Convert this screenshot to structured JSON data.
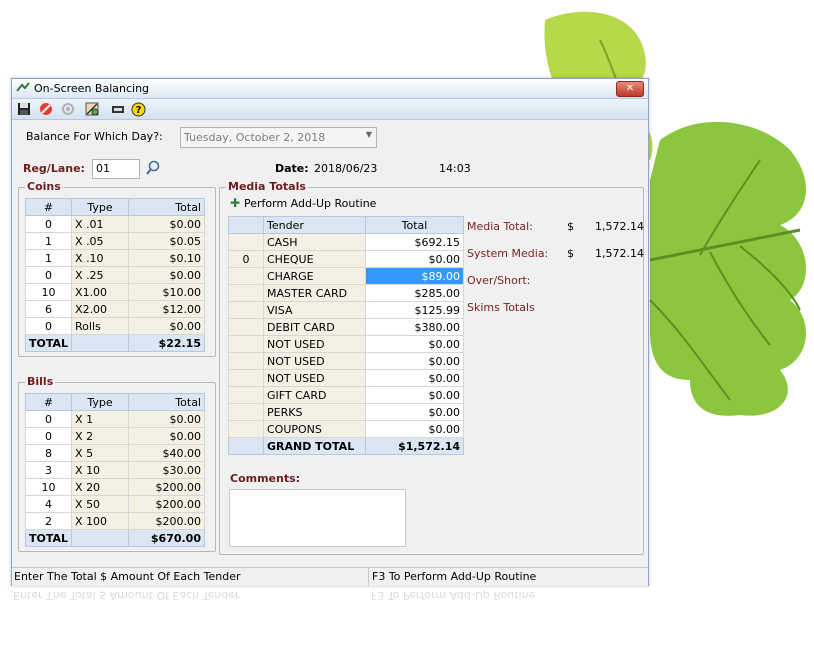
{
  "window": {
    "title": "On-Screen Balancing",
    "close_glyph": "✕"
  },
  "toolbar": {
    "icons": [
      "save-icon",
      "cancel-icon",
      "refresh-icon",
      "calculator-icon",
      "cash-drawer-icon",
      "help-icon"
    ],
    "help_glyph": "?"
  },
  "balance_day": {
    "label": "Balance For Which Day?:",
    "value": "Tuesday, October 2, 2018"
  },
  "reg_lane": {
    "label": "Reg/Lane:",
    "value": "01"
  },
  "date": {
    "label": "Date:",
    "value": "2018/06/23",
    "time": "14:03"
  },
  "coins": {
    "title": "Coins",
    "headers": [
      "#",
      "Type",
      "Total"
    ],
    "rows": [
      [
        "0",
        "X .01",
        "$0.00"
      ],
      [
        "1",
        "X .05",
        "$0.05"
      ],
      [
        "1",
        "X .10",
        "$0.10"
      ],
      [
        "0",
        "X .25",
        "$0.00"
      ],
      [
        "10",
        "X1.00",
        "$10.00"
      ],
      [
        "6",
        "X2.00",
        "$12.00"
      ],
      [
        "0",
        "Rolls",
        "$0.00"
      ]
    ],
    "total_label": "TOTAL",
    "total_value": "$22.15"
  },
  "bills": {
    "title": "Bills",
    "headers": [
      "#",
      "Type",
      "Total"
    ],
    "rows": [
      [
        "0",
        "X  1",
        "$0.00"
      ],
      [
        "0",
        "X  2",
        "$0.00"
      ],
      [
        "8",
        "X  5",
        "$40.00"
      ],
      [
        "3",
        "X  10",
        "$30.00"
      ],
      [
        "10",
        "X  20",
        "$200.00"
      ],
      [
        "4",
        "X  50",
        "$200.00"
      ],
      [
        "2",
        "X 100",
        "$200.00"
      ]
    ],
    "total_label": "TOTAL",
    "total_value": "$670.00"
  },
  "media": {
    "title": "Media Totals",
    "addup_label": "Perform Add-Up Routine",
    "headers": [
      "",
      "Tender",
      "Total"
    ],
    "rows": [
      [
        "",
        "CASH",
        "$692.15"
      ],
      [
        "0",
        "CHEQUE",
        "$0.00"
      ],
      [
        "",
        "CHARGE",
        "$89.00"
      ],
      [
        "",
        "MASTER CARD",
        "$285.00"
      ],
      [
        "",
        "VISA",
        "$125.99"
      ],
      [
        "",
        "DEBIT CARD",
        "$380.00"
      ],
      [
        "",
        "NOT USED",
        "$0.00"
      ],
      [
        "",
        "NOT USED",
        "$0.00"
      ],
      [
        "",
        "NOT USED",
        "$0.00"
      ],
      [
        "",
        "GIFT CARD",
        "$0.00"
      ],
      [
        "",
        "PERKS",
        "$0.00"
      ],
      [
        "",
        "COUPONS",
        "$0.00"
      ]
    ],
    "selected_row": 2,
    "grand_total_label": "GRAND TOTAL",
    "grand_total_value": "$1,572.14"
  },
  "summary": {
    "media_total_label": "Media Total:",
    "media_total_currency": "$",
    "media_total_value": "1,572.14",
    "system_media_label": "System Media:",
    "system_media_currency": "$",
    "system_media_value": "1,572.14",
    "over_short_label": "Over/Short:",
    "skims_label": "Skims Totals"
  },
  "comments": {
    "label": "Comments:",
    "value": ""
  },
  "status": {
    "left": "Enter The Total $ Amount Of Each Tender",
    "right": "F3 To Perform Add-Up Routine"
  },
  "colors": {
    "accent_maroon": "#7a1f1f",
    "header_blue": "#dae6f3",
    "selection": "#3399ff",
    "leaf_green": "#8cc63f"
  }
}
